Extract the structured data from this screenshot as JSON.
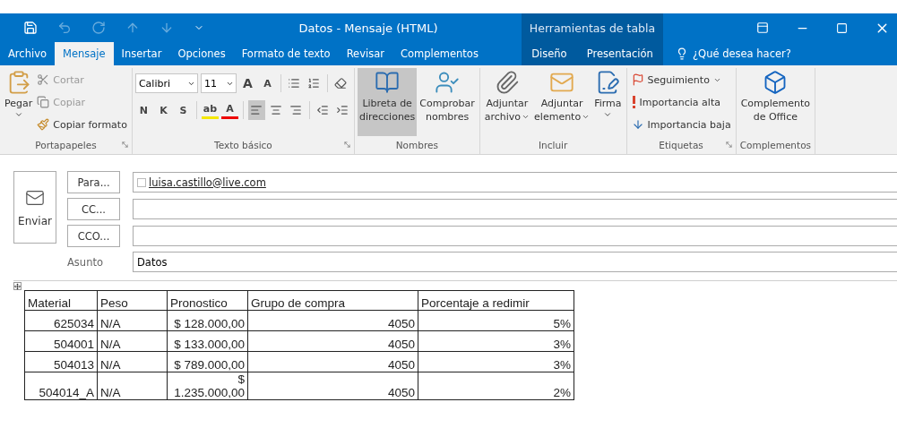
{
  "window": {
    "title": "Datos - Mensaje (HTML)",
    "context_title": "Herramientas de tabla"
  },
  "quick_access": [
    {
      "disabled": false
    },
    {
      "disabled": true
    },
    {
      "disabled": true
    },
    {
      "disabled": true
    },
    {
      "disabled": true
    },
    {
      "disabled": false
    }
  ],
  "tabs": [
    {
      "label": "Archivo",
      "selected": false,
      "contextual": false
    },
    {
      "label": "Mensaje",
      "selected": true,
      "contextual": false
    },
    {
      "label": "Insertar",
      "selected": false,
      "contextual": false
    },
    {
      "label": "Opciones",
      "selected": false,
      "contextual": false
    },
    {
      "label": "Formato de texto",
      "selected": false,
      "contextual": false
    },
    {
      "label": "Revisar",
      "selected": false,
      "contextual": false
    },
    {
      "label": "Complementos",
      "selected": false,
      "contextual": false
    },
    {
      "label": "Diseño",
      "selected": false,
      "contextual": true
    },
    {
      "label": "Presentación",
      "selected": false,
      "contextual": true
    }
  ],
  "tell_me": "¿Qué desea hacer?",
  "ribbon": {
    "groups": [
      {
        "label": "Portapapeles",
        "launcher": true,
        "items": [
          {
            "kind": "large",
            "label": [
              "Pegar"
            ],
            "menu": true,
            "selected": false
          },
          {
            "kind": "stack",
            "items": [
              {
                "label": "Cortar",
                "disabled": true
              },
              {
                "label": "Copiar",
                "disabled": true
              },
              {
                "label": "Copiar formato",
                "disabled": false
              }
            ]
          }
        ]
      },
      {
        "label": "Texto básico",
        "launcher": true,
        "items": [
          {
            "kind": "format",
            "font": "Calibri",
            "size": "11",
            "rows": [
              [
                {
                  "kind": "grow",
                  "label": "A",
                  "selected": false
                },
                {
                  "kind": "shrink",
                  "label": "A",
                  "selected": false
                },
                {
                  "kind": "sep"
                },
                {
                  "kind": "bullets",
                  "selected": false
                },
                {
                  "kind": "numbering",
                  "selected": false
                },
                {
                  "kind": "sep"
                },
                {
                  "kind": "clear",
                  "selected": false
                }
              ],
              [
                {
                  "kind": "letter",
                  "label": "N",
                  "selected": false
                },
                {
                  "kind": "letter",
                  "label": "K",
                  "selected": false
                },
                {
                  "kind": "letter",
                  "label": "S",
                  "selected": false
                },
                {
                  "kind": "sep"
                },
                {
                  "kind": "highlight",
                  "label": "ab",
                  "selected": false
                },
                {
                  "kind": "color",
                  "label": "A",
                  "selected": false
                },
                {
                  "kind": "sep"
                },
                {
                  "kind": "align-left",
                  "selected": true
                },
                {
                  "kind": "align-center",
                  "selected": false
                },
                {
                  "kind": "align-right",
                  "selected": false
                },
                {
                  "kind": "sep"
                },
                {
                  "kind": "outdent",
                  "selected": false
                },
                {
                  "kind": "indent",
                  "selected": false
                }
              ]
            ]
          }
        ]
      },
      {
        "label": "Nombres",
        "items": [
          {
            "kind": "large",
            "label": [
              "Libreta de",
              "direcciones"
            ],
            "selected": true
          },
          {
            "kind": "large",
            "label": [
              "Comprobar",
              "nombres"
            ],
            "selected": false
          }
        ]
      },
      {
        "label": "Incluir",
        "items": [
          {
            "kind": "large",
            "label": [
              "Adjuntar",
              "archivo"
            ],
            "menu": true,
            "selected": false
          },
          {
            "kind": "large",
            "label": [
              "Adjuntar",
              "elemento"
            ],
            "menu": true,
            "selected": false
          },
          {
            "kind": "large",
            "label": [
              "Firma"
            ],
            "menu": true,
            "selected": false
          }
        ]
      },
      {
        "label": "Etiquetas",
        "launcher": true,
        "items": [
          {
            "kind": "stack",
            "items": [
              {
                "label": "Seguimiento",
                "disabled": false,
                "menu": true
              },
              {
                "label": "Importancia alta",
                "disabled": false
              },
              {
                "label": "Importancia baja",
                "disabled": false
              }
            ]
          }
        ]
      },
      {
        "label": "Complementos",
        "items": [
          {
            "kind": "large",
            "label": [
              "Complemento",
              "de Office"
            ],
            "selected": false
          }
        ]
      }
    ]
  },
  "compose": {
    "send": "Enviar",
    "fields": [
      {
        "kind": "button",
        "label": "Para...",
        "value": "luisa.castillo@live.com"
      },
      {
        "kind": "button",
        "label": "CC..."
      },
      {
        "kind": "button",
        "label": "CCO..."
      },
      {
        "kind": "label",
        "label": "Asunto",
        "value": "Datos"
      }
    ]
  },
  "table": {
    "columns": [
      "Material",
      "Peso",
      "Pronostico",
      "Grupo de compra",
      "Porcentaje a redimir"
    ],
    "rows": [
      [
        "625034",
        "N/A",
        "$ 128.000,00",
        "4050",
        "5%"
      ],
      [
        "504001",
        "N/A",
        "$ 133.000,00",
        "4050",
        "3%"
      ],
      [
        "504013",
        "N/A",
        "$ 789.000,00",
        "4050",
        "3%"
      ],
      [
        "504014_A",
        "N/A",
        "$ 1.235.000,00",
        "4050",
        "2%"
      ]
    ]
  }
}
